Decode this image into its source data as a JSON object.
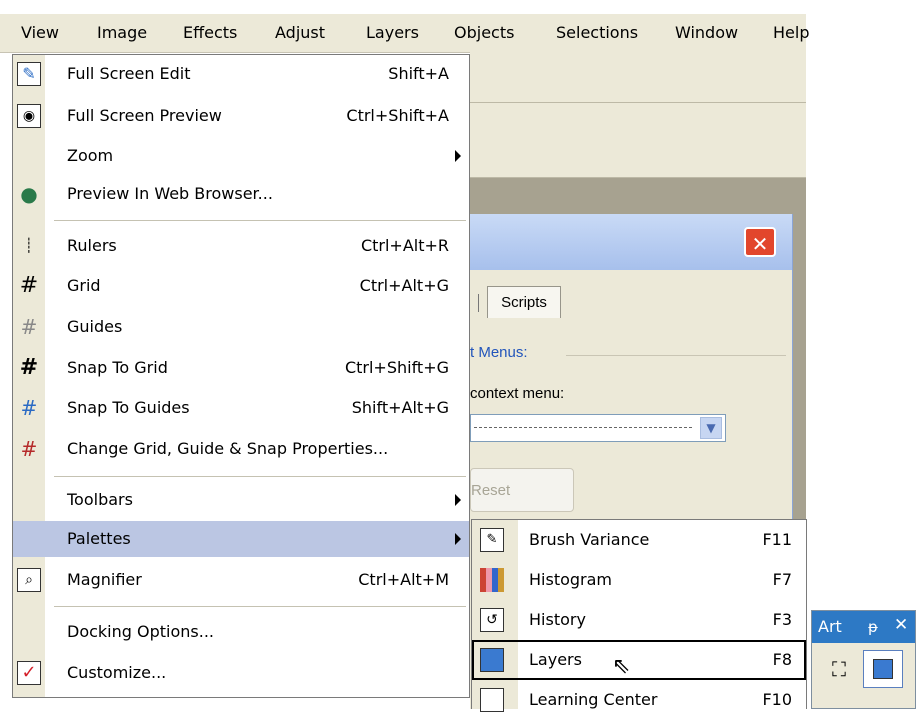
{
  "menubar": {
    "items": [
      "View",
      "Image",
      "Effects",
      "Adjust",
      "Layers",
      "Objects",
      "Selections",
      "Window",
      "Help"
    ]
  },
  "view_menu": {
    "items": [
      {
        "label": "Full Screen Edit",
        "shortcut": "Shift+A",
        "icon": "paintbrush-icon"
      },
      {
        "label": "Full Screen Preview",
        "shortcut": "Ctrl+Shift+A",
        "icon": "eye-icon"
      },
      {
        "label": "Zoom",
        "shortcut": "",
        "icon": ""
      },
      {
        "label": "Preview In Web Browser...",
        "shortcut": "",
        "icon": "globe-icon"
      },
      {
        "label": "Rulers",
        "shortcut": "Ctrl+Alt+R",
        "icon": "ruler-icon"
      },
      {
        "label": "Grid",
        "shortcut": "Ctrl+Alt+G",
        "icon": "grid-icon"
      },
      {
        "label": "Guides",
        "shortcut": "",
        "icon": "guides-icon"
      },
      {
        "label": "Snap To Grid",
        "shortcut": "Ctrl+Shift+G",
        "icon": "snap-grid-icon"
      },
      {
        "label": "Snap To Guides",
        "shortcut": "Shift+Alt+G",
        "icon": "snap-guides-icon"
      },
      {
        "label": "Change Grid, Guide & Snap Properties...",
        "shortcut": "",
        "icon": "grid-properties-icon"
      },
      {
        "label": "Toolbars",
        "shortcut": "",
        "icon": ""
      },
      {
        "label": "Palettes",
        "shortcut": "",
        "icon": ""
      },
      {
        "label": "Magnifier",
        "shortcut": "Ctrl+Alt+M",
        "icon": "magnifier-icon"
      },
      {
        "label": "Docking Options...",
        "shortcut": "",
        "icon": ""
      },
      {
        "label": "Customize...",
        "shortcut": "",
        "icon": "checkbox-icon"
      }
    ]
  },
  "palettes_submenu": {
    "items": [
      {
        "label": "Brush Variance",
        "shortcut": "F11"
      },
      {
        "label": "Histogram",
        "shortcut": "F7"
      },
      {
        "label": "History",
        "shortcut": "F3"
      },
      {
        "label": "Layers",
        "shortcut": "F8"
      },
      {
        "label": "Learning Center",
        "shortcut": "F10"
      }
    ]
  },
  "dialog": {
    "tab_scripts": "Scripts",
    "group_label": "t Menus:",
    "context_label": "context menu:",
    "reset_button": "Reset"
  },
  "art_palette": {
    "title": "Art",
    "pin": "ᵽ",
    "close": "✕"
  }
}
